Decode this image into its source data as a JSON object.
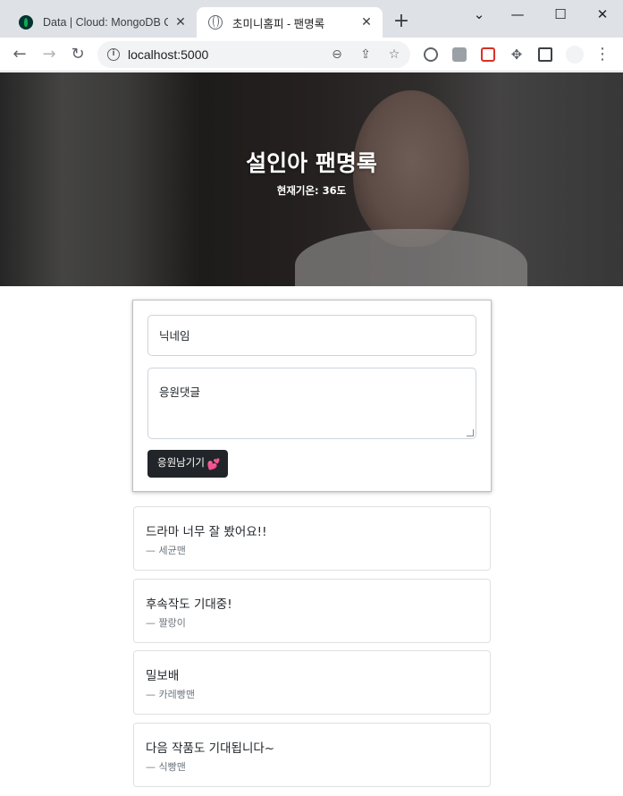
{
  "browser": {
    "tabs": [
      {
        "title": "Data | Cloud: MongoDB Cl",
        "active": false
      },
      {
        "title": "초미니홈피 - 팬명록",
        "active": true
      }
    ],
    "url": "localhost:5000",
    "new_tab_label": "+",
    "window_controls": {
      "minimize": "—",
      "maximize": "☐",
      "close": "✕",
      "tab_search": "⌄"
    }
  },
  "hero": {
    "title": "설인아 팬명록",
    "temperature_label": "현재기온: 36도"
  },
  "form": {
    "nickname_placeholder": "닉네임",
    "comment_placeholder": "응원댓글",
    "submit_label": "응원남기기",
    "submit_icon": "💕"
  },
  "comments": [
    {
      "comment": "드라마 너무 잘 봤어요!!",
      "author": "— 세균맨"
    },
    {
      "comment": "후속작도 기대중!",
      "author": "— 짤랑이"
    },
    {
      "comment": "밀보배",
      "author": "— 카레빵맨"
    },
    {
      "comment": "다음 작품도 기대됩니다~",
      "author": "— 식빵맨"
    }
  ],
  "colors": {
    "button_bg": "#212529",
    "tabstrip_bg": "#dee1e6",
    "heart": "#ff3d7f"
  }
}
